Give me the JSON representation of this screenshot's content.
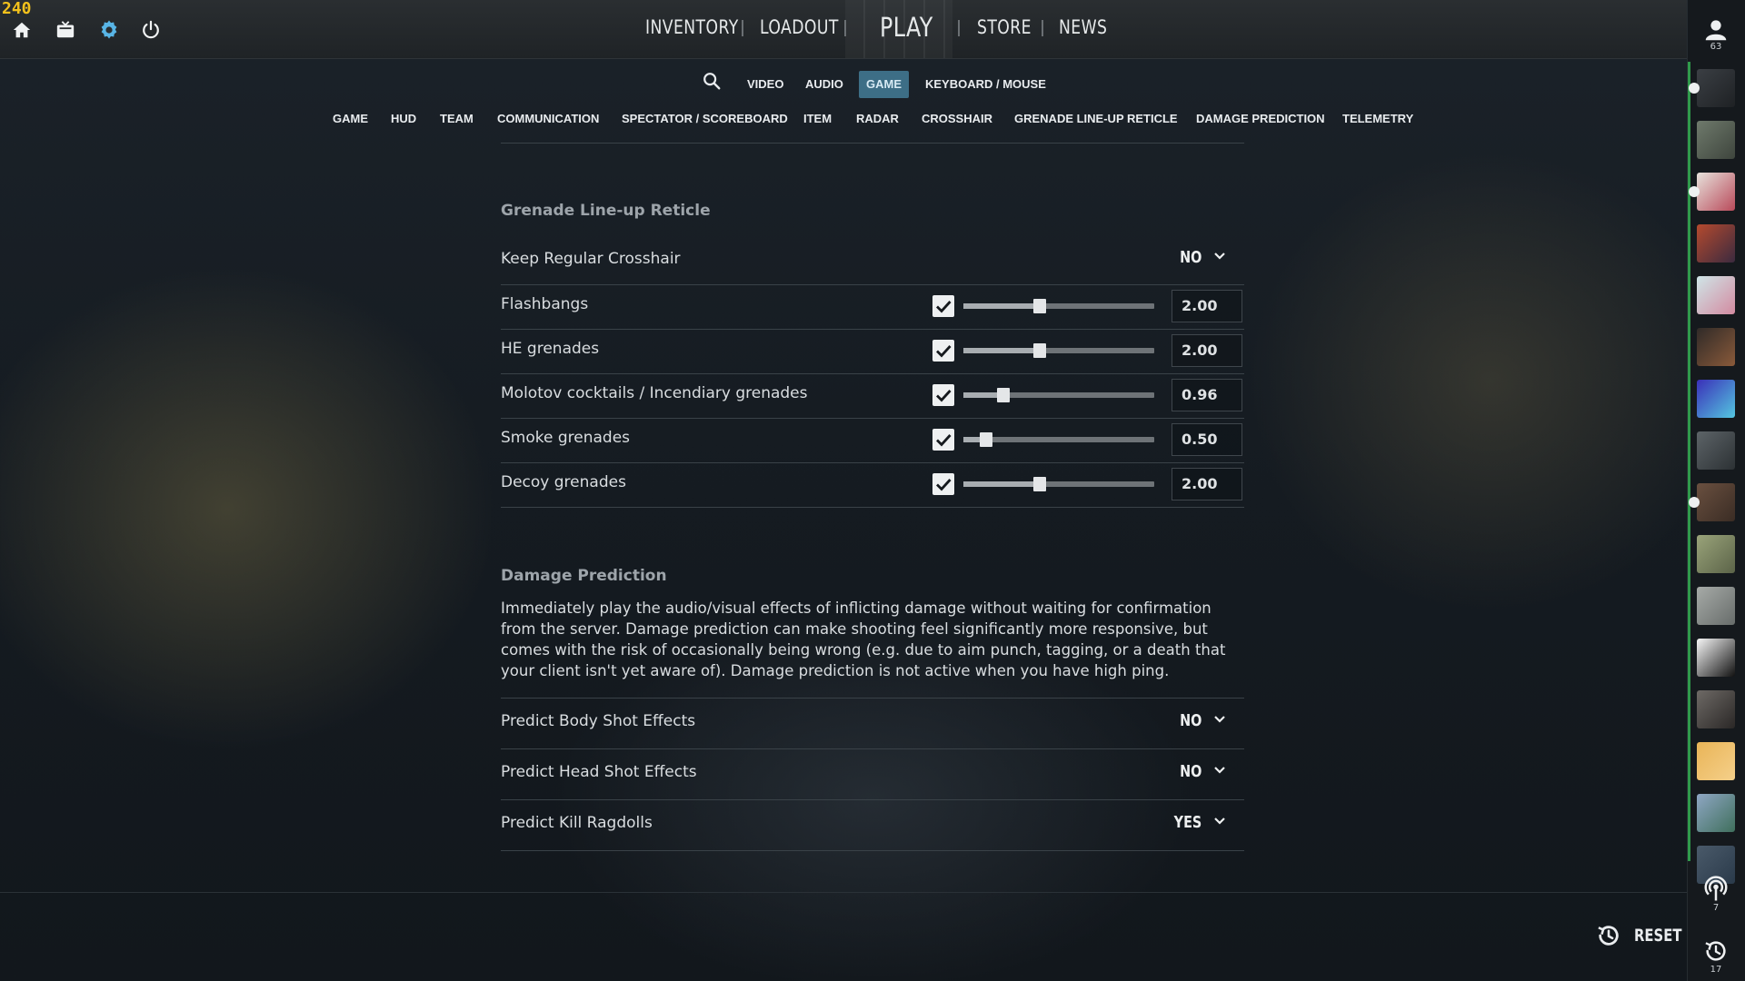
{
  "fps_counter": "240",
  "top_icons": [
    "home-icon",
    "tv-icon",
    "gear-icon",
    "power-icon"
  ],
  "main_nav": {
    "inventory": "INVENTORY",
    "loadout": "LOADOUT",
    "play": "PLAY",
    "store": "STORE",
    "news": "NEWS"
  },
  "profile": {
    "level": "63"
  },
  "settings_tabs": [
    "VIDEO",
    "AUDIO",
    "GAME",
    "KEYBOARD / MOUSE"
  ],
  "active_settings_tab": "GAME",
  "category_tabs": [
    "GAME",
    "HUD",
    "TEAM",
    "COMMUNICATION",
    "SPECTATOR / SCOREBOARD",
    "ITEM",
    "RADAR",
    "CROSSHAIR",
    "GRENADE LINE-UP RETICLE",
    "DAMAGE PREDICTION",
    "TELEMETRY"
  ],
  "grenade_section": {
    "title": "Grenade Line-up Reticle",
    "keep_crosshair": {
      "label": "Keep Regular Crosshair",
      "value": "NO"
    },
    "sliders": [
      {
        "label": "Flashbangs",
        "checked": true,
        "value": "2.00",
        "level": 0.4
      },
      {
        "label": "HE grenades",
        "checked": true,
        "value": "2.00",
        "level": 0.4
      },
      {
        "label": "Molotov cocktails / Incendiary grenades",
        "checked": true,
        "value": "0.96",
        "level": 0.21
      },
      {
        "label": "Smoke grenades",
        "checked": true,
        "value": "0.50",
        "level": 0.12
      },
      {
        "label": "Decoy grenades",
        "checked": true,
        "value": "2.00",
        "level": 0.4
      }
    ]
  },
  "damage_section": {
    "title": "Damage Prediction",
    "description": "Immediately play the audio/visual effects of inflicting damage without waiting for confirmation from the server. Damage prediction can make shooting feel significantly more responsive, but comes with the risk of occasionally being wrong (e.g. due to aim punch, tagging, or a death that your client isn't yet aware of). Damage prediction is not active when you have high ping.",
    "options": [
      {
        "label": "Predict Body Shot Effects",
        "value": "NO"
      },
      {
        "label": "Predict Head Shot Effects",
        "value": "NO"
      },
      {
        "label": "Predict Kill Ragdolls",
        "value": "YES"
      }
    ]
  },
  "reset_label": "RESET",
  "right_bar": {
    "broadcast_count": "7",
    "history_count": "17"
  },
  "colors": {
    "accent": "#3d6e86",
    "fps": "#f2c11c",
    "online": "#2f9a4b"
  }
}
